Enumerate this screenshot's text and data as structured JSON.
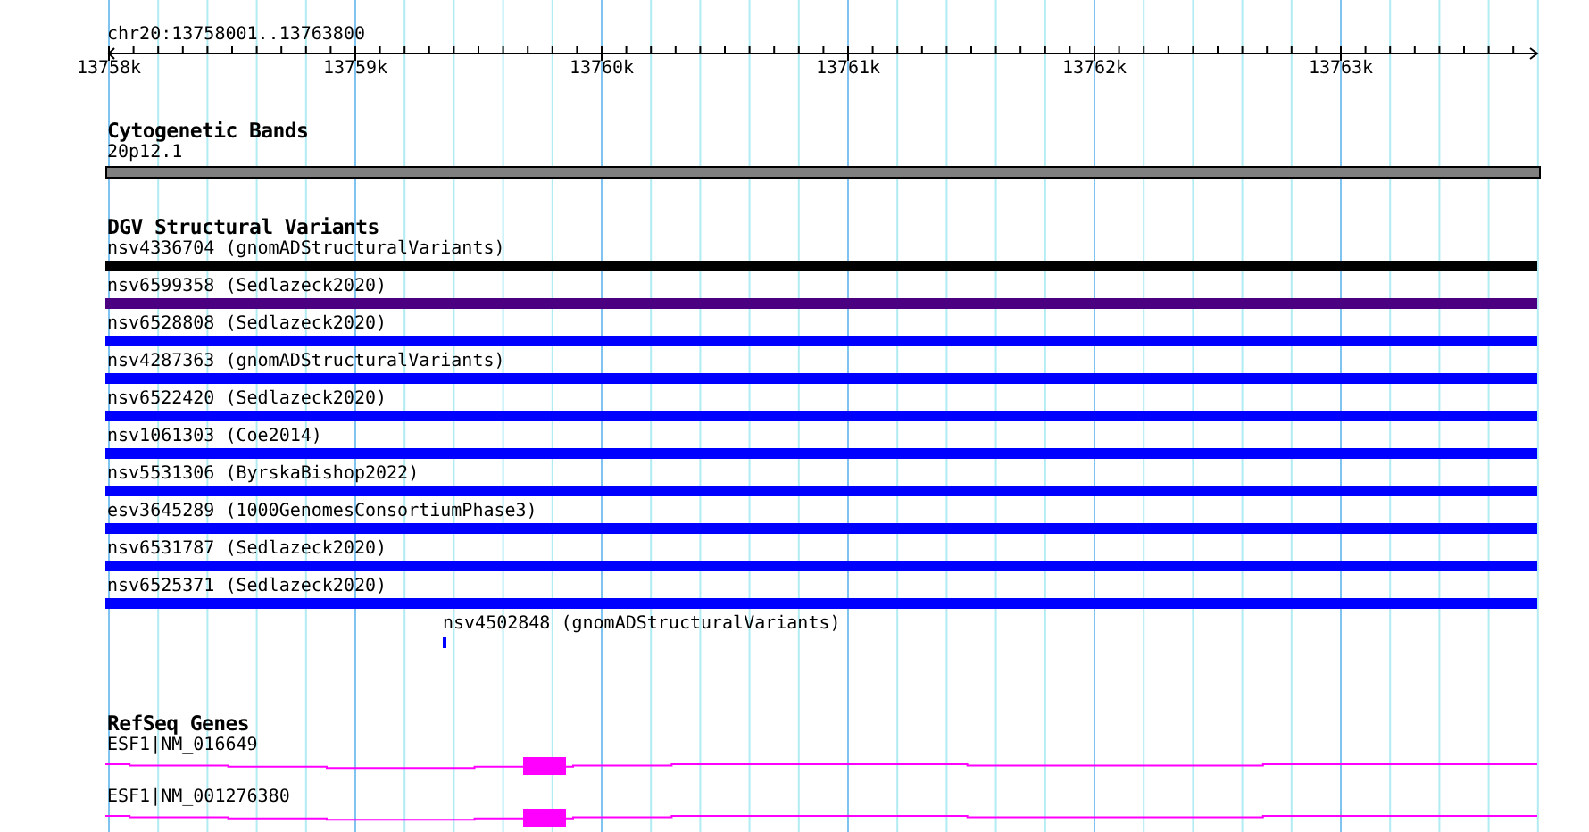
{
  "location": "chr20:13758001..13763800",
  "ruler": {
    "labels": [
      "13758k",
      "13759k",
      "13760k",
      "13761k",
      "13762k",
      "13763k"
    ]
  },
  "tracks": [
    {
      "kind": "bands",
      "title": "Cytogenetic Bands",
      "features": [
        {
          "kind": "span",
          "label": "20p12.1",
          "color": "#808080"
        }
      ]
    },
    {
      "kind": "variants",
      "title": "DGV Structural Variants",
      "features": [
        {
          "kind": "span",
          "label": "nsv4336704 (gnomADStructuralVariants)",
          "color": "#000000"
        },
        {
          "kind": "span",
          "label": "nsv6599358 (Sedlazeck2020)",
          "color": "#4b0082"
        },
        {
          "kind": "span",
          "label": "nsv6528808 (Sedlazeck2020)",
          "color": "#0000ff"
        },
        {
          "kind": "span",
          "label": "nsv4287363 (gnomADStructuralVariants)",
          "color": "#0000ff"
        },
        {
          "kind": "span",
          "label": "nsv6522420 (Sedlazeck2020)",
          "color": "#0000ff"
        },
        {
          "kind": "span",
          "label": "nsv1061303 (Coe2014)",
          "color": "#0000ff"
        },
        {
          "kind": "span",
          "label": "nsv5531306 (ByrskaBishop2022)",
          "color": "#0000ff"
        },
        {
          "kind": "span",
          "label": "esv3645289 (1000GenomesConsortiumPhase3)",
          "color": "#0000ff"
        },
        {
          "kind": "span",
          "label": "nsv6531787 (Sedlazeck2020)",
          "color": "#0000ff"
        },
        {
          "kind": "span",
          "label": "nsv6525371 (Sedlazeck2020)",
          "color": "#0000ff"
        },
        {
          "kind": "point",
          "label": "nsv4502848 (gnomADStructuralVariants)",
          "color": "#0000ff"
        }
      ]
    },
    {
      "kind": "genes",
      "title": "RefSeq Genes",
      "features": [
        {
          "kind": "gene",
          "label": "ESF1|NM_016649",
          "color": "#ff00ff"
        },
        {
          "kind": "gene",
          "label": "ESF1|NM_001276380",
          "color": "#ff00ff"
        }
      ]
    }
  ]
}
